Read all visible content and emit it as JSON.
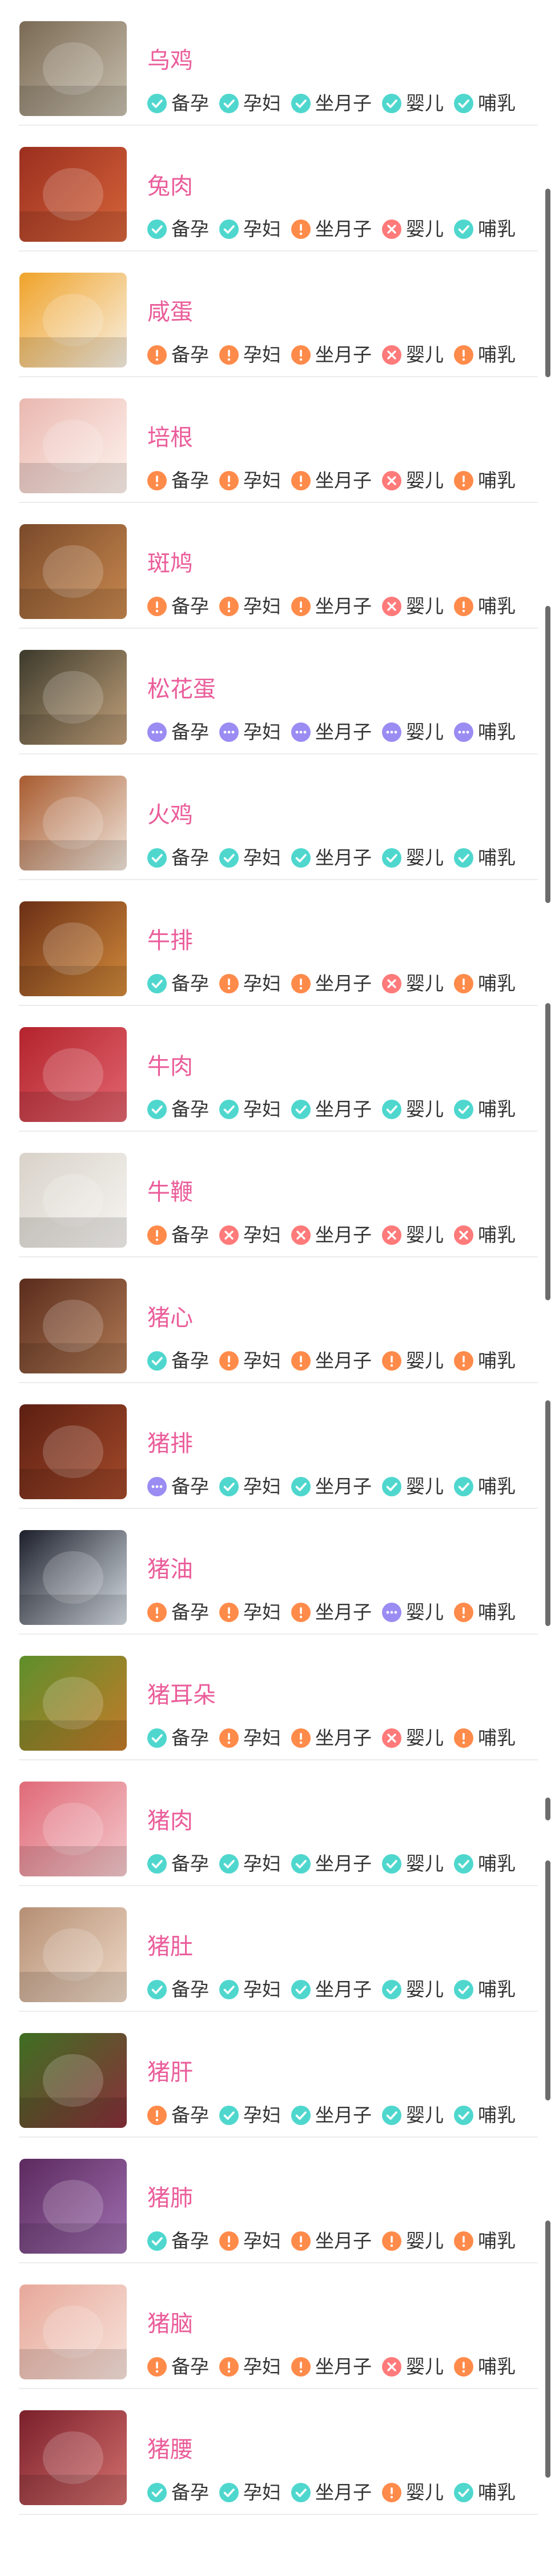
{
  "categories": [
    "备孕",
    "孕妇",
    "坐月子",
    "婴儿",
    "哺乳"
  ],
  "status_legend": {
    "ok": "check-icon",
    "warn": "exclamation-icon",
    "no": "cross-icon",
    "unk": "ellipsis-icon"
  },
  "status_colors": {
    "ok": "#4fd7ce",
    "warn": "#ff8b4b",
    "no": "#ff7a7a",
    "unk": "#9a8cf2"
  },
  "title_color": "#ea5d9a",
  "items": [
    {
      "name": "乌鸡",
      "img": "silkie-chicken-soup-photo",
      "status": [
        "ok",
        "ok",
        "ok",
        "ok",
        "ok"
      ]
    },
    {
      "name": "兔肉",
      "img": "rabbit-meat-photo",
      "status": [
        "ok",
        "ok",
        "warn",
        "no",
        "ok"
      ]
    },
    {
      "name": "咸蛋",
      "img": "salted-egg-photo",
      "status": [
        "warn",
        "warn",
        "warn",
        "no",
        "warn"
      ]
    },
    {
      "name": "培根",
      "img": "bacon-photo",
      "status": [
        "warn",
        "warn",
        "warn",
        "no",
        "warn"
      ]
    },
    {
      "name": "斑鸠",
      "img": "turtledove-photo",
      "status": [
        "warn",
        "warn",
        "warn",
        "no",
        "warn"
      ]
    },
    {
      "name": "松花蛋",
      "img": "century-egg-photo",
      "status": [
        "unk",
        "unk",
        "unk",
        "unk",
        "unk"
      ]
    },
    {
      "name": "火鸡",
      "img": "turkey-photo",
      "status": [
        "ok",
        "ok",
        "ok",
        "ok",
        "ok"
      ]
    },
    {
      "name": "牛排",
      "img": "beef-steak-photo",
      "status": [
        "ok",
        "warn",
        "warn",
        "no",
        "warn"
      ]
    },
    {
      "name": "牛肉",
      "img": "beef-photo",
      "status": [
        "ok",
        "ok",
        "ok",
        "ok",
        "ok"
      ]
    },
    {
      "name": "牛鞭",
      "img": "ox-penis-photo",
      "status": [
        "warn",
        "no",
        "no",
        "no",
        "no"
      ]
    },
    {
      "name": "猪心",
      "img": "pig-heart-photo",
      "status": [
        "ok",
        "warn",
        "warn",
        "warn",
        "warn"
      ]
    },
    {
      "name": "猪排",
      "img": "pork-ribs-photo",
      "status": [
        "unk",
        "ok",
        "ok",
        "ok",
        "ok"
      ]
    },
    {
      "name": "猪油",
      "img": "lard-photo",
      "status": [
        "warn",
        "warn",
        "warn",
        "unk",
        "warn"
      ]
    },
    {
      "name": "猪耳朵",
      "img": "pig-ear-photo",
      "status": [
        "ok",
        "warn",
        "warn",
        "no",
        "warn"
      ]
    },
    {
      "name": "猪肉",
      "img": "pork-photo",
      "status": [
        "ok",
        "ok",
        "ok",
        "ok",
        "ok"
      ]
    },
    {
      "name": "猪肚",
      "img": "pig-stomach-photo",
      "status": [
        "ok",
        "ok",
        "ok",
        "ok",
        "ok"
      ]
    },
    {
      "name": "猪肝",
      "img": "pig-liver-photo",
      "status": [
        "warn",
        "ok",
        "ok",
        "ok",
        "ok"
      ]
    },
    {
      "name": "猪肺",
      "img": "pig-lung-photo",
      "status": [
        "ok",
        "warn",
        "warn",
        "warn",
        "warn"
      ]
    },
    {
      "name": "猪脑",
      "img": "pig-brain-photo",
      "status": [
        "warn",
        "warn",
        "warn",
        "no",
        "warn"
      ]
    },
    {
      "name": "猪腰",
      "img": "pig-kidney-photo",
      "status": [
        "ok",
        "ok",
        "ok",
        "warn",
        "ok"
      ]
    }
  ],
  "image_palette": [
    [
      "#7a6a54",
      "#c8bfae"
    ],
    [
      "#9b2f1f",
      "#d6643a"
    ],
    [
      "#f0a32a",
      "#f8f1e4"
    ],
    [
      "#e9b8b0",
      "#fff3ee"
    ],
    [
      "#7a4a2a",
      "#c9894f"
    ],
    [
      "#3c3a2c",
      "#c2a17a"
    ],
    [
      "#a85b2f",
      "#f1e6dc"
    ],
    [
      "#6b2f15",
      "#d28a3b"
    ],
    [
      "#b3232c",
      "#e36670"
    ],
    [
      "#d8d2c9",
      "#f7f5f2"
    ],
    [
      "#5a2c1c",
      "#b07a55"
    ],
    [
      "#5c1f12",
      "#a44a2a"
    ],
    [
      "#1c1f2a",
      "#d8dfe6"
    ],
    [
      "#5e8f2b",
      "#c47a2a"
    ],
    [
      "#e06a78",
      "#f4c9cc"
    ],
    [
      "#b58f74",
      "#f0dac8"
    ],
    [
      "#3e6f22",
      "#8a2f3a"
    ],
    [
      "#5c2a5e",
      "#9f6fb0"
    ],
    [
      "#e7a89a",
      "#f8e4dc"
    ],
    [
      "#7a1f2a",
      "#d4706e"
    ]
  ]
}
